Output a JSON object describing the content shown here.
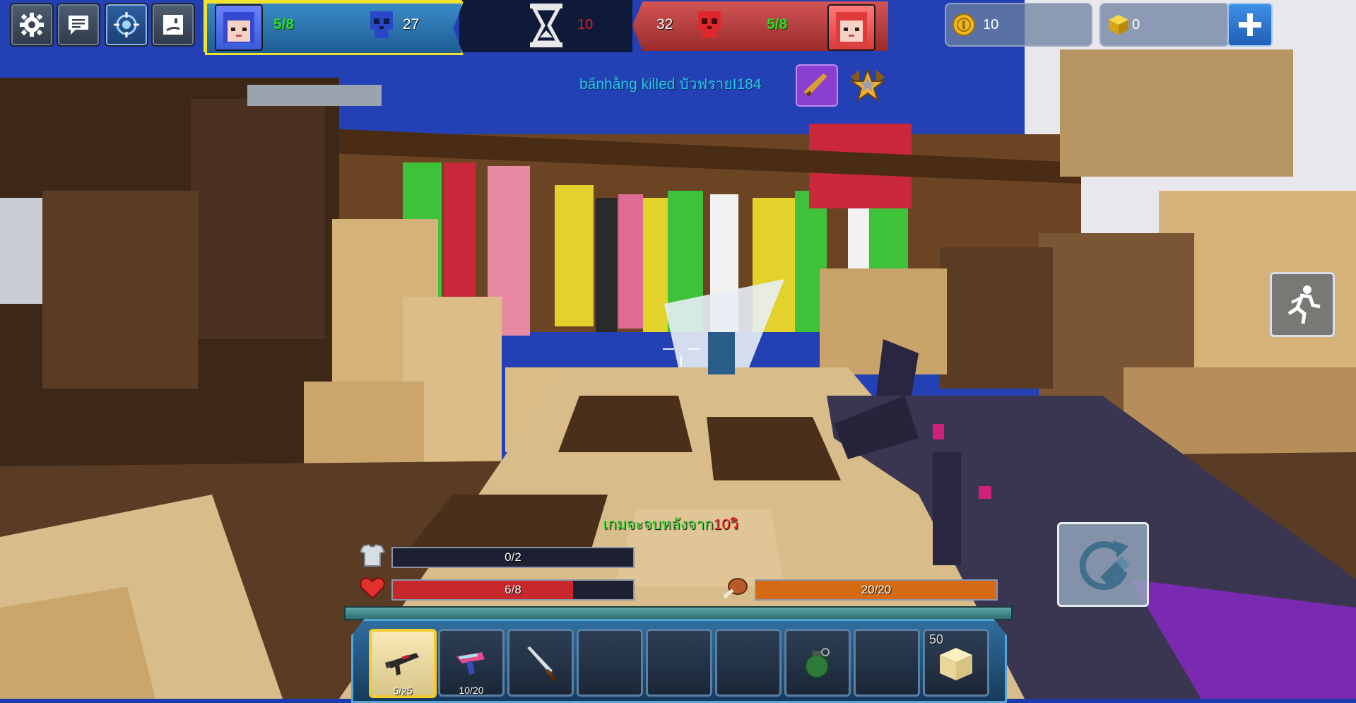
{
  "top_left_buttons": [
    {
      "name": "settings",
      "icon": "gear-icon"
    },
    {
      "name": "chat",
      "icon": "chat-icon"
    },
    {
      "name": "target",
      "icon": "target-icon"
    },
    {
      "name": "emote",
      "icon": "emote-icon"
    }
  ],
  "team_blue": {
    "alive": "5/8",
    "kills": "27",
    "color": "#2f7fbf"
  },
  "team_red": {
    "kills": "32",
    "alive": "5/8",
    "color": "#c84040"
  },
  "timer": {
    "value": "10",
    "icon": "hourglass-icon"
  },
  "currency": {
    "coins": "10",
    "gems": "0",
    "coin_icon": "coin-icon",
    "gem_icon": "gold-cube-icon",
    "add_icon": "plus-icon"
  },
  "kill_feed": {
    "text": "bấnhằng killed บัวฟรายI184",
    "weapon_icon": "rifle-icon",
    "badge_icon": "star-badge-icon"
  },
  "countdown": {
    "text": "เกมจะจบหลังจาก",
    "number": "10วิ"
  },
  "armor": {
    "label": "0/2",
    "fraction": 0.0,
    "icon": "armor-icon"
  },
  "health": {
    "label": "6/8",
    "fraction": 0.75,
    "icon": "heart-icon",
    "color": "#c7282c"
  },
  "hunger": {
    "label": "20/20",
    "fraction": 1.0,
    "icon": "meat-icon",
    "color": "#d46a14"
  },
  "hotbar": [
    {
      "item": "assault-rifle",
      "count": "5/25",
      "selected": true
    },
    {
      "item": "blaster-pistol",
      "count": "10/20",
      "selected": false
    },
    {
      "item": "sword",
      "count": "",
      "selected": false
    },
    {
      "item": "empty",
      "count": "",
      "selected": false
    },
    {
      "item": "empty",
      "count": "",
      "selected": false
    },
    {
      "item": "empty",
      "count": "",
      "selected": false
    },
    {
      "item": "grenade",
      "count": "",
      "selected": false
    },
    {
      "item": "empty",
      "count": "",
      "selected": false
    },
    {
      "item": "sand-block",
      "count": "50",
      "selected": false
    }
  ],
  "action_buttons": {
    "sprint_icon": "sprint-icon",
    "reload_icon": "reload-icon"
  }
}
